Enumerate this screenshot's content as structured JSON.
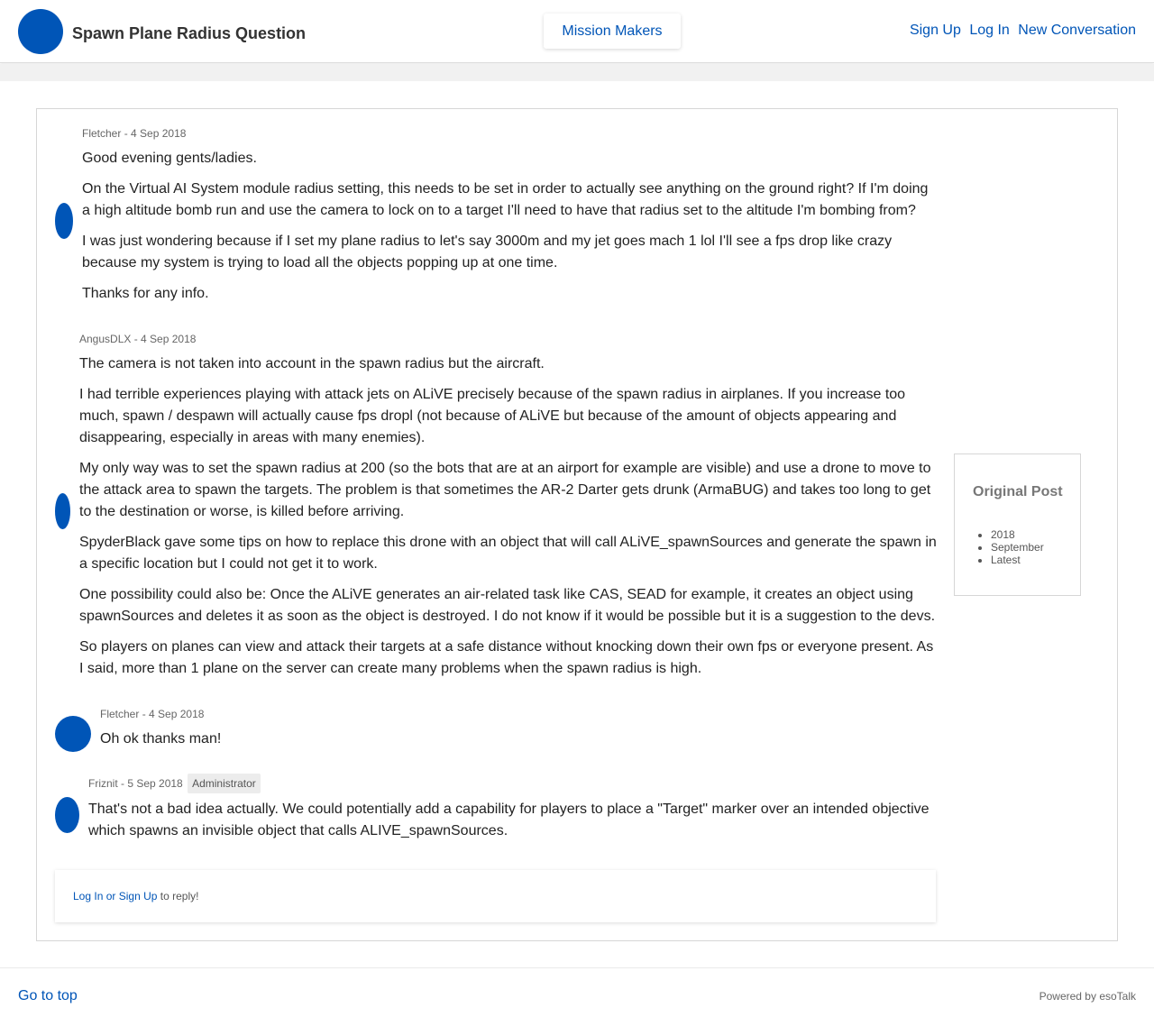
{
  "header": {
    "title": "Spawn Plane Radius Question",
    "channel": "Mission Makers",
    "links": [
      "Sign Up",
      "Log In",
      "New Conversation"
    ],
    "brand_color": "#0055b7"
  },
  "posts": [
    {
      "author": "Fletcher",
      "date": "4 Sep 2018",
      "paragraphs": [
        "Good evening gents/ladies.",
        "On the Virtual AI System module radius setting, this needs to be set in order to actually see anything on the ground right? If I'm doing a high altitude bomb run and use the camera to lock on to a target I'll need to have that radius set to the altitude I'm bombing from?",
        "I was just wondering because if I set my plane radius to let's say 3000m and my jet goes mach 1 lol I'll see a fps drop like crazy because my system is trying to load all the objects popping up at one time.",
        "Thanks for any info."
      ]
    },
    {
      "author": "AngusDLX",
      "date": "4 Sep 2018",
      "paragraphs": [
        "The camera is not taken into account in the spawn radius but the aircraft.",
        "I had terrible experiences playing with attack jets on ALiVE precisely because of the spawn radius in airplanes. If you increase too much, spawn / despawn will actually cause fps dropl (not because of ALiVE but because of the amount of objects appearing and disappearing, especially in areas with many enemies).",
        "My only way was to set the spawn radius at 200 (so the bots that are at an airport for example are visible) and use a drone to move to the attack area to spawn the targets. The problem is that sometimes the AR-2 Darter gets drunk (ArmaBUG) and takes too long to get to the destination or worse, is killed before arriving.",
        "SpyderBlack gave some tips on how to replace this drone with an object that will call ALiVE_spawnSources and generate the spawn in a specific location but I could not get it to work.",
        "One possibility could also be: Once the ALiVE generates an air-related task like CAS, SEAD for example, it creates an object using spawnSources and deletes it as soon as the object is destroyed. I do not know if it would be possible but it is a suggestion to the devs.",
        "So players on planes can view and attack their targets at a safe distance without knocking down their own fps or everyone present. As I said, more than 1 plane on the server can create many problems when the spawn radius is high."
      ]
    },
    {
      "author": "Fletcher",
      "date": "4 Sep 2018",
      "paragraphs": [
        "Oh ok thanks man!"
      ]
    },
    {
      "author": "Friznit",
      "date": "5 Sep 2018",
      "badge": "Administrator",
      "paragraphs": [
        "That's not a bad idea actually. We could potentially add a capability for players to place a \"Target\" marker over an intended objective which spawns an invisible object that calls ALIVE_spawnSources."
      ]
    }
  ],
  "reply": {
    "login": "Log In",
    "or": "or",
    "signup": "Sign Up",
    "suffix": "to reply!"
  },
  "sidebar": {
    "heading": "Original Post",
    "items": [
      "2018",
      "September",
      "Latest"
    ]
  },
  "footer": {
    "go_top": "Go to top",
    "powered": "Powered by esoTalk"
  }
}
